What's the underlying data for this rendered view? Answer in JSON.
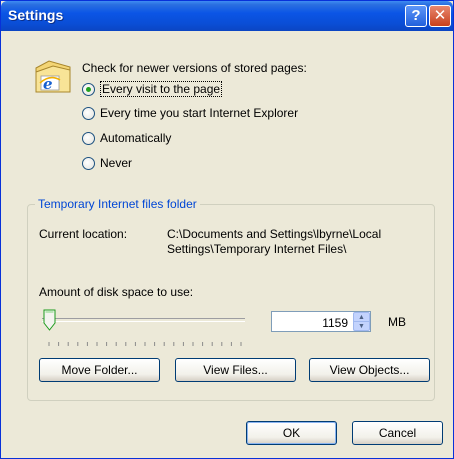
{
  "window": {
    "title": "Settings",
    "help_glyph": "?",
    "close_glyph": "✕",
    "title_color": "#0a4ed6"
  },
  "check": {
    "label": "Check for newer versions of stored pages:",
    "icon": "ie-folder-icon",
    "options": [
      {
        "label": "Every visit to the page",
        "selected": true
      },
      {
        "label": "Every time you start Internet Explorer",
        "selected": false
      },
      {
        "label": "Automatically",
        "selected": false
      },
      {
        "label": "Never",
        "selected": false
      }
    ]
  },
  "temp_folder": {
    "group_title": "Temporary Internet files folder",
    "current_location_label": "Current location:",
    "current_location_value_line1": "C:\\Documents and Settings\\lbyrne\\Local",
    "current_location_value_line2": "Settings\\Temporary Internet Files\\",
    "disk_space_label": "Amount of disk space to use:",
    "disk_space_value": "1159",
    "disk_space_unit": "MB",
    "slider_fraction": 0.0,
    "buttons": {
      "move_folder": "Move Folder...",
      "view_files": "View Files...",
      "view_objects": "View Objects..."
    }
  },
  "footer": {
    "ok": "OK",
    "cancel": "Cancel"
  },
  "colors": {
    "group_title": "#0046d5",
    "radio_dot": "#21a121",
    "dialog_bg": "#ece9d8"
  }
}
